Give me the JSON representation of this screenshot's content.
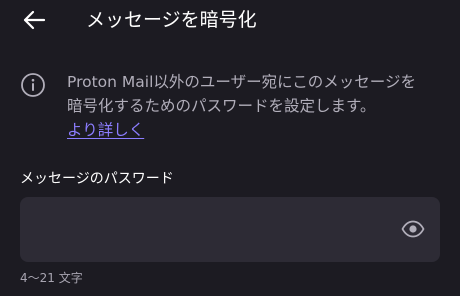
{
  "header": {
    "title": "メッセージを暗号化",
    "back_icon": "arrow-left-icon"
  },
  "info": {
    "icon": "info-circle-icon",
    "line1": "Proton Mail以外のユーザー宛にこのメッセージを",
    "line2": "暗号化するためのパスワードを設定します。",
    "learn_more": "より詳しく"
  },
  "password_field": {
    "label": "メッセージのパスワード",
    "value": "",
    "toggle_icon": "eye-icon",
    "helper": "4〜21 文字"
  },
  "colors": {
    "background": "#1c1b22",
    "input_background": "#2d2b35",
    "link": "#8c7dff",
    "secondary_text": "#b1aeba"
  }
}
